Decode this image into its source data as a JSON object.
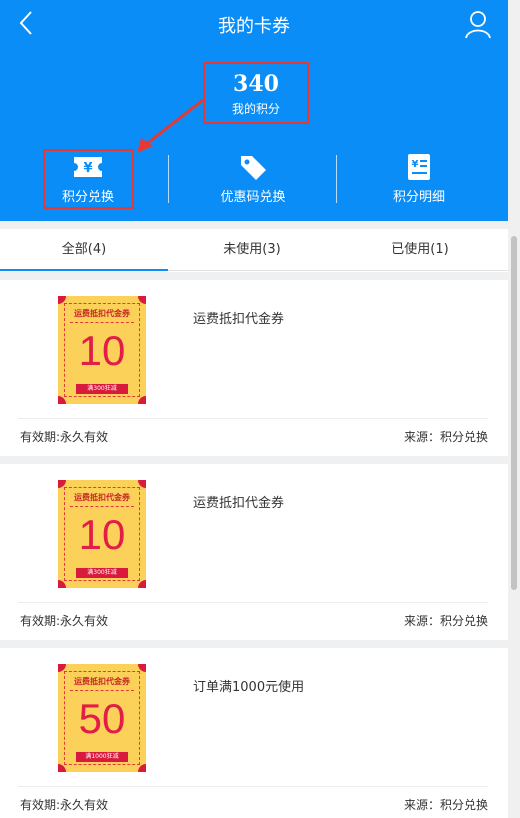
{
  "header": {
    "title": "我的卡券",
    "back_icon": "chevron-left-icon",
    "user_icon": "user-icon",
    "background": "#0b8df7"
  },
  "points": {
    "value": "340",
    "label": "我的积分"
  },
  "actions": [
    {
      "label": "积分兑换",
      "icon": "yen-ticket-icon"
    },
    {
      "label": "优惠码兑换",
      "icon": "tag-icon"
    },
    {
      "label": "积分明细",
      "icon": "yen-list-icon"
    }
  ],
  "tabs": [
    {
      "label": "全部(4)",
      "active": true
    },
    {
      "label": "未使用(3)",
      "active": false
    },
    {
      "label": "已使用(1)",
      "active": false
    }
  ],
  "coupons": [
    {
      "coupon_title": "运费抵扣代金券",
      "amount": "10",
      "condition": "满300狂减",
      "name": "运费抵扣代金券",
      "validity": "有效期:永久有效",
      "source": "来源：积分兑换"
    },
    {
      "coupon_title": "运费抵扣代金券",
      "amount": "10",
      "condition": "满300狂减",
      "name": "运费抵扣代金券",
      "validity": "有效期:永久有效",
      "source": "来源：积分兑换"
    },
    {
      "coupon_title": "运费抵扣代金券",
      "amount": "50",
      "condition": "满1000狂减",
      "name": "订单满1000元使用",
      "validity": "有效期:永久有效",
      "source": "来源：积分兑换"
    }
  ],
  "colors": {
    "accent": "#0b8df7",
    "highlight": "#e53935",
    "coupon_bg": "#fcd15a",
    "coupon_red": "#e11d48"
  }
}
